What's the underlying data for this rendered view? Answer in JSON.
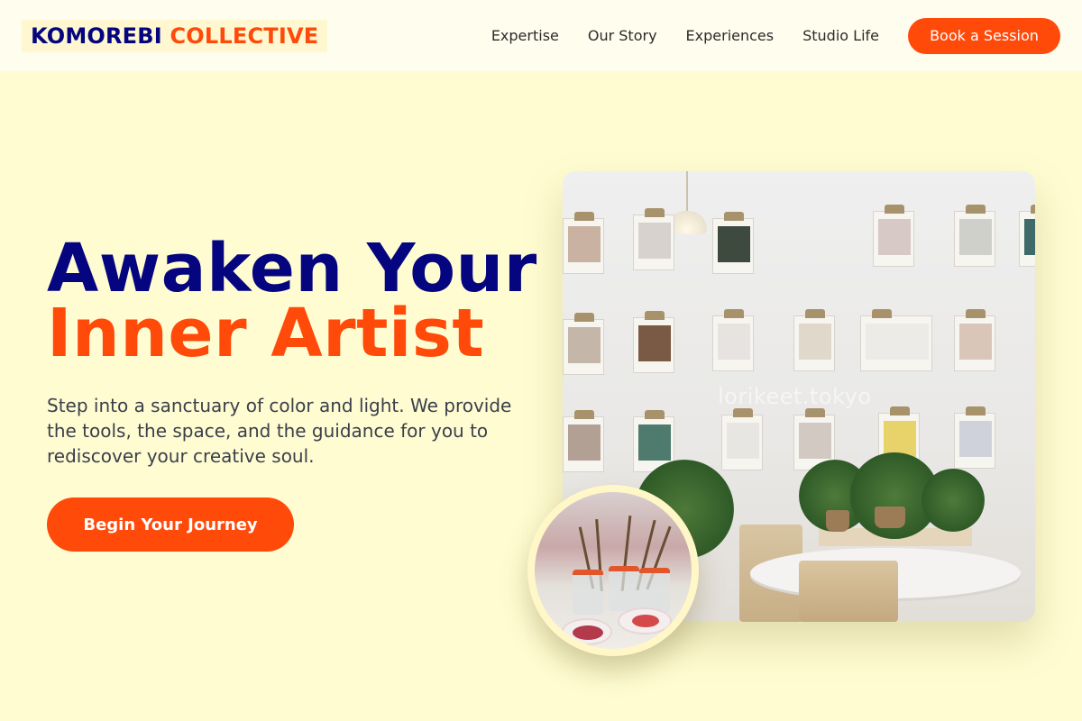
{
  "header": {
    "logo_part1": "KOMOREBI",
    "logo_part2": "COLLECTIVE",
    "nav": [
      "Expertise",
      "Our Story",
      "Experiences",
      "Studio Life"
    ],
    "cta": "Book a Session"
  },
  "hero": {
    "headline_line1": "Awaken Your",
    "headline_line2": "Inner Artist",
    "subtext": "Step into a sanctuary of color and light. We provide the tools, the space, and the guidance for you to rediscover your creative soul.",
    "button": "Begin Your Journey",
    "photo_watermark": "lorikeet.tokyo"
  },
  "colors": {
    "background": "#fffcd2",
    "header_bg": "#fffdee",
    "navy": "#050580",
    "accent": "#ff4a0a"
  }
}
